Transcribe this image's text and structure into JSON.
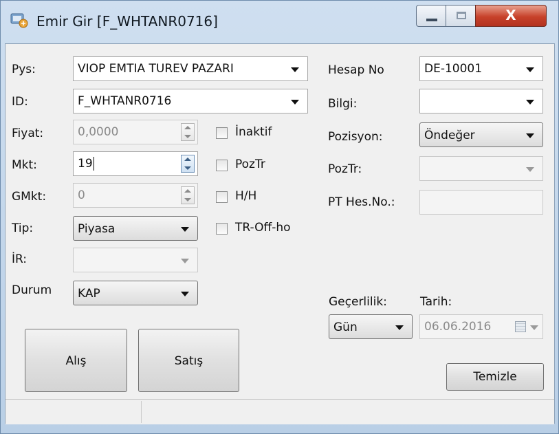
{
  "window": {
    "title": "Emir Gir [F_WHTANR0716]",
    "close_glyph": "X"
  },
  "form": {
    "pys": {
      "label": "Pys:",
      "value": "VIOP EMTIA TUREV PAZARI"
    },
    "id": {
      "label": "ID:",
      "value": "F_WHTANR0716"
    },
    "fiyat": {
      "label": "Fiyat:",
      "value": "0,0000"
    },
    "mkt": {
      "label": "Mkt:",
      "value": "19"
    },
    "gmkt": {
      "label": "GMkt:",
      "value": "0"
    },
    "tip": {
      "label": "Tip:",
      "value": "Piyasa"
    },
    "ir": {
      "label": "İR:",
      "value": ""
    },
    "durum": {
      "label": "Durum",
      "value": "KAP"
    },
    "checks": {
      "inaktif": "İnaktif",
      "poztr": "PozTr",
      "hh": "H/H",
      "troff": "TR-Off-ho"
    },
    "hesap": {
      "label": "Hesap No",
      "value": "DE-10001"
    },
    "bilgi": {
      "label": "Bilgi:",
      "value": ""
    },
    "pozisyon": {
      "label": "Pozisyon:",
      "value": "Öndeğer"
    },
    "poztr_right": {
      "label": "PozTr:",
      "value": ""
    },
    "pthes": {
      "label": "PT Hes.No.:",
      "value": ""
    },
    "gecerlilik": {
      "label": "Geçerlilik:",
      "value": "Gün"
    },
    "tarih": {
      "label": "Tarih:",
      "value": "06.06.2016"
    }
  },
  "buttons": {
    "alis": "Alış",
    "satis": "Satış",
    "temizle": "Temizle"
  },
  "status": {
    "left": "",
    "right": ""
  },
  "colors": {
    "close_button": "#c7412a",
    "client_bg": "#f0f0f0",
    "field_border": "#a6a6a6"
  }
}
